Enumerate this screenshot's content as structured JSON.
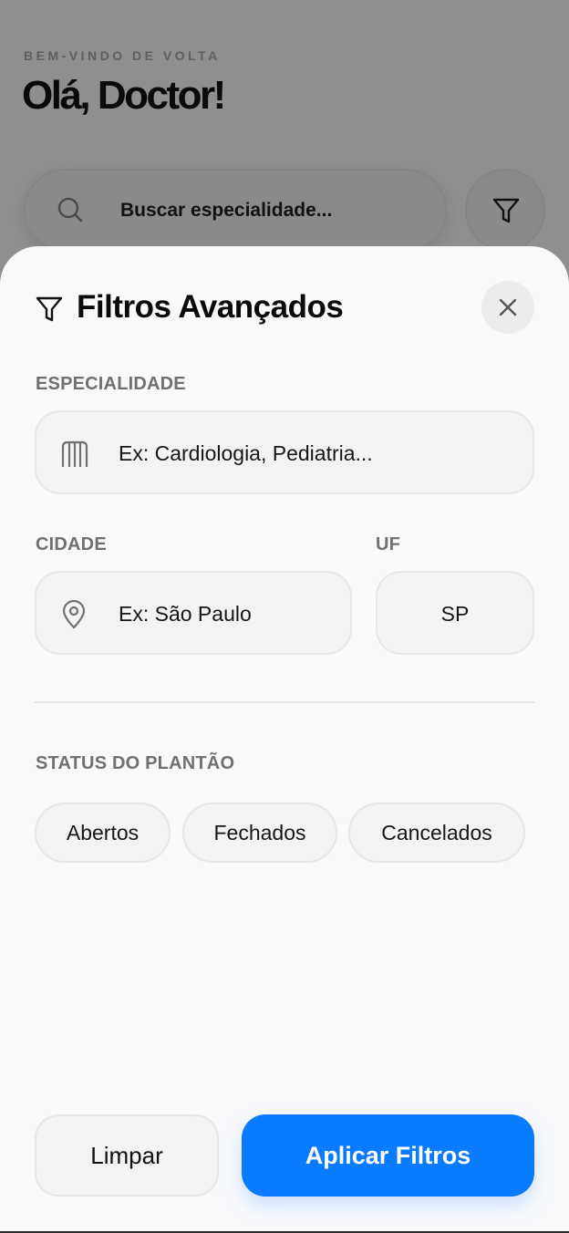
{
  "background": {
    "welcome": "BEM-VINDO DE VOLTA",
    "greeting": "Olá, Doctor!",
    "search_placeholder": "Buscar especialidade..."
  },
  "sheet": {
    "title": "Filtros Avançados",
    "specialty": {
      "label": "ESPECIALIDADE",
      "placeholder": "Ex: Cardiologia, Pediatria..."
    },
    "city": {
      "label": "CIDADE",
      "placeholder": "Ex: São Paulo"
    },
    "state": {
      "label": "UF",
      "value": "SP"
    },
    "status": {
      "label": "STATUS DO PLANTÃO",
      "options": [
        "Abertos",
        "Fechados",
        "Cancelados"
      ]
    },
    "actions": {
      "clear": "Limpar",
      "apply": "Aplicar Filtros"
    }
  },
  "colors": {
    "accent": "#0a7aff",
    "overlay": "#8f8f8f",
    "sheet_bg": "#f8f9fb"
  }
}
